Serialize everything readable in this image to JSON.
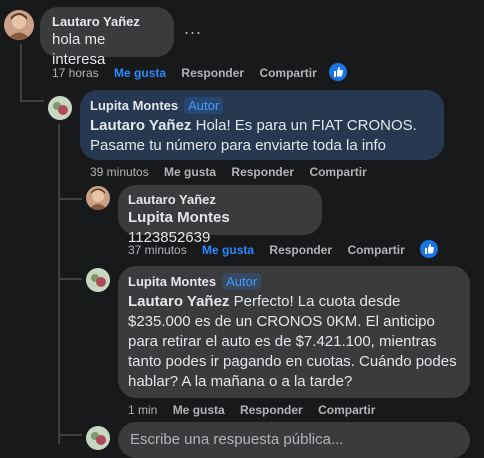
{
  "thread": {
    "top_comment": {
      "author": "Lautaro Yañez",
      "text": "hola me interesa",
      "actions": {
        "time": "17 horas",
        "like": "Me gusta",
        "reply": "Responder",
        "share": "Compartir"
      }
    },
    "reply1": {
      "author": "Lupita Montes",
      "badge": "Autor",
      "mention": "Lautaro Yañez",
      "text": " Hola! Es para un FIAT CRONOS. Pasame tu número para enviarte toda la info",
      "actions": {
        "time": "39 minutos",
        "like": "Me gusta",
        "reply": "Responder",
        "share": "Compartir"
      }
    },
    "reply2": {
      "author": "Lautaro Yañez",
      "mention": "Lupita Montes",
      "text": " 1123852639",
      "actions": {
        "time": "37 minutos",
        "like": "Me gusta",
        "reply": "Responder",
        "share": "Compartir"
      }
    },
    "reply3": {
      "author": "Lupita Montes",
      "badge": "Autor",
      "mention": "Lautaro Yañez",
      "text": " Perfecto! La cuota desde $235.000 es de un CRONOS 0KM. El anticipo para retirar el auto es de $7.421.100, mientras tanto podes ir pagando en cuotas. Cuándo podes hablar? A la mañana o a la tarde?",
      "actions": {
        "time": "1 min",
        "like": "Me gusta",
        "reply": "Responder",
        "share": "Compartir"
      }
    },
    "reply_input": {
      "placeholder": "Escribe una respuesta pública..."
    },
    "more_options": "...",
    "colors": {
      "background": "#18191a",
      "bubble": "#3a3b3c",
      "author_bubble": "#263951",
      "accent": "#2d88ff"
    },
    "icons": [
      "like-icon",
      "more-options-icon",
      "avatar"
    ]
  }
}
